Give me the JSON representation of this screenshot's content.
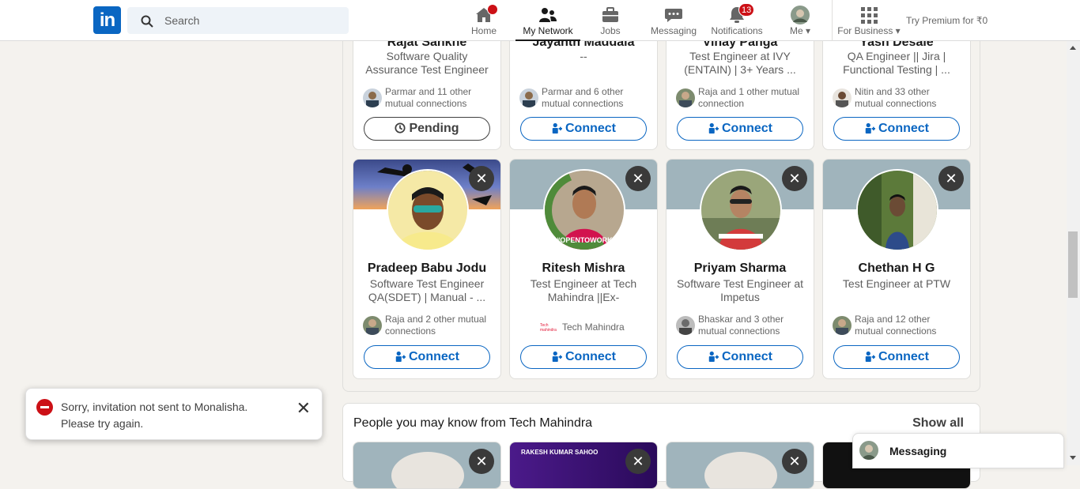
{
  "nav": {
    "search_placeholder": "Search",
    "items": [
      {
        "label": "Home",
        "badge": ""
      },
      {
        "label": "My Network",
        "badge": ""
      },
      {
        "label": "Jobs",
        "badge": ""
      },
      {
        "label": "Messaging",
        "badge": ""
      },
      {
        "label": "Notifications",
        "badge": "13"
      },
      {
        "label": "Me",
        "badge": ""
      }
    ],
    "for_business": "For Business",
    "premium": "Try Premium for ₹0"
  },
  "top_row": [
    {
      "name": "Rajat Sankhe",
      "title": "Software Quality Assurance Test Engineer",
      "mutual": "Parmar and 11 other mutual connections",
      "button": "Pending"
    },
    {
      "name": "Jayanth Maddala",
      "title": "--",
      "mutual": "Parmar and 6 other mutual connections",
      "button": "Connect"
    },
    {
      "name": "Vinay Panga",
      "title": "Test Engineer at IVY (ENTAIN) | 3+ Years ...",
      "mutual": "Raja and 1 other mutual connection",
      "button": "Connect"
    },
    {
      "name": "Yash Desale",
      "title": "QA Engineer || Jira | Functional Testing | ...",
      "mutual": "Nitin and 33 other mutual connections",
      "button": "Connect"
    }
  ],
  "people": [
    {
      "name": "Pradeep Babu Jodu",
      "title": "Software Test Engineer QA(SDET) | Manual - ...",
      "mutual": "Raja and 2 other mutual connections",
      "button": "Connect",
      "dismiss": "✕"
    },
    {
      "name": "Ritesh Mishra",
      "title": "Test Engineer at Tech Mahindra ||Ex-Cognizant...",
      "mutual": "Tech Mahindra",
      "button": "Connect",
      "dismiss": "✕",
      "badge_text": "#OPENTOWORK"
    },
    {
      "name": "Priyam Sharma",
      "title": "Software Test Engineer at Impetus",
      "mutual": "Bhaskar and 3 other mutual connections",
      "button": "Connect",
      "dismiss": "✕"
    },
    {
      "name": "Chethan H G",
      "title": "Test Engineer at PTW",
      "mutual": "Raja and 12 other mutual connections",
      "button": "Connect",
      "dismiss": "✕"
    }
  ],
  "section": {
    "title": "People you may know from Tech Mahindra",
    "show_all": "Show all",
    "banner_text": "RAKESH KUMAR SAHOO"
  },
  "toast": {
    "message_line1": "Sorry, invitation not sent to Monalisha.",
    "message_line2": "Please try again.",
    "close": "✕"
  },
  "messaging": {
    "label": "Messaging"
  },
  "colors": {
    "brand": "#0a66c2",
    "badge": "#cc1016",
    "background": "#f4f2ee"
  }
}
